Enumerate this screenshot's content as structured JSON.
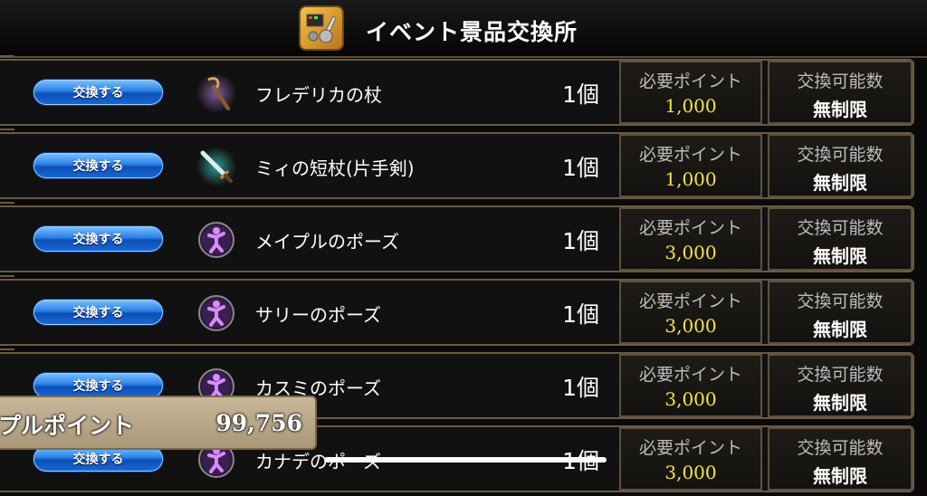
{
  "header": {
    "title": "イベント景品交換所"
  },
  "columns": {
    "points_label": "必要ポイント",
    "limit_label": "交換可能数"
  },
  "exchange_label": "交換する",
  "rows": [
    {
      "name": "フレデリカの杖",
      "qty": "1個",
      "points": "1,000",
      "limit": "無制限",
      "icon": "staff-icon"
    },
    {
      "name": "ミィの短杖(片手剣)",
      "qty": "1個",
      "points": "1,000",
      "limit": "無制限",
      "icon": "sword-icon"
    },
    {
      "name": "メイプルのポーズ",
      "qty": "1個",
      "points": "3,000",
      "limit": "無制限",
      "icon": "pose-icon"
    },
    {
      "name": "サリーのポーズ",
      "qty": "1個",
      "points": "3,000",
      "limit": "無制限",
      "icon": "pose-icon"
    },
    {
      "name": "カスミのポーズ",
      "qty": "1個",
      "points": "3,000",
      "limit": "無制限",
      "icon": "pose-icon"
    },
    {
      "name": "カナデのポーズ",
      "qty": "1個",
      "points": "3,000",
      "limit": "無制限",
      "icon": "pose-icon"
    }
  ],
  "footer": {
    "label": "プルポイント",
    "value": "99,756"
  },
  "colors": {
    "points": "#f7e53d",
    "button": "#2a7fe6",
    "border": "#6a5a45"
  }
}
